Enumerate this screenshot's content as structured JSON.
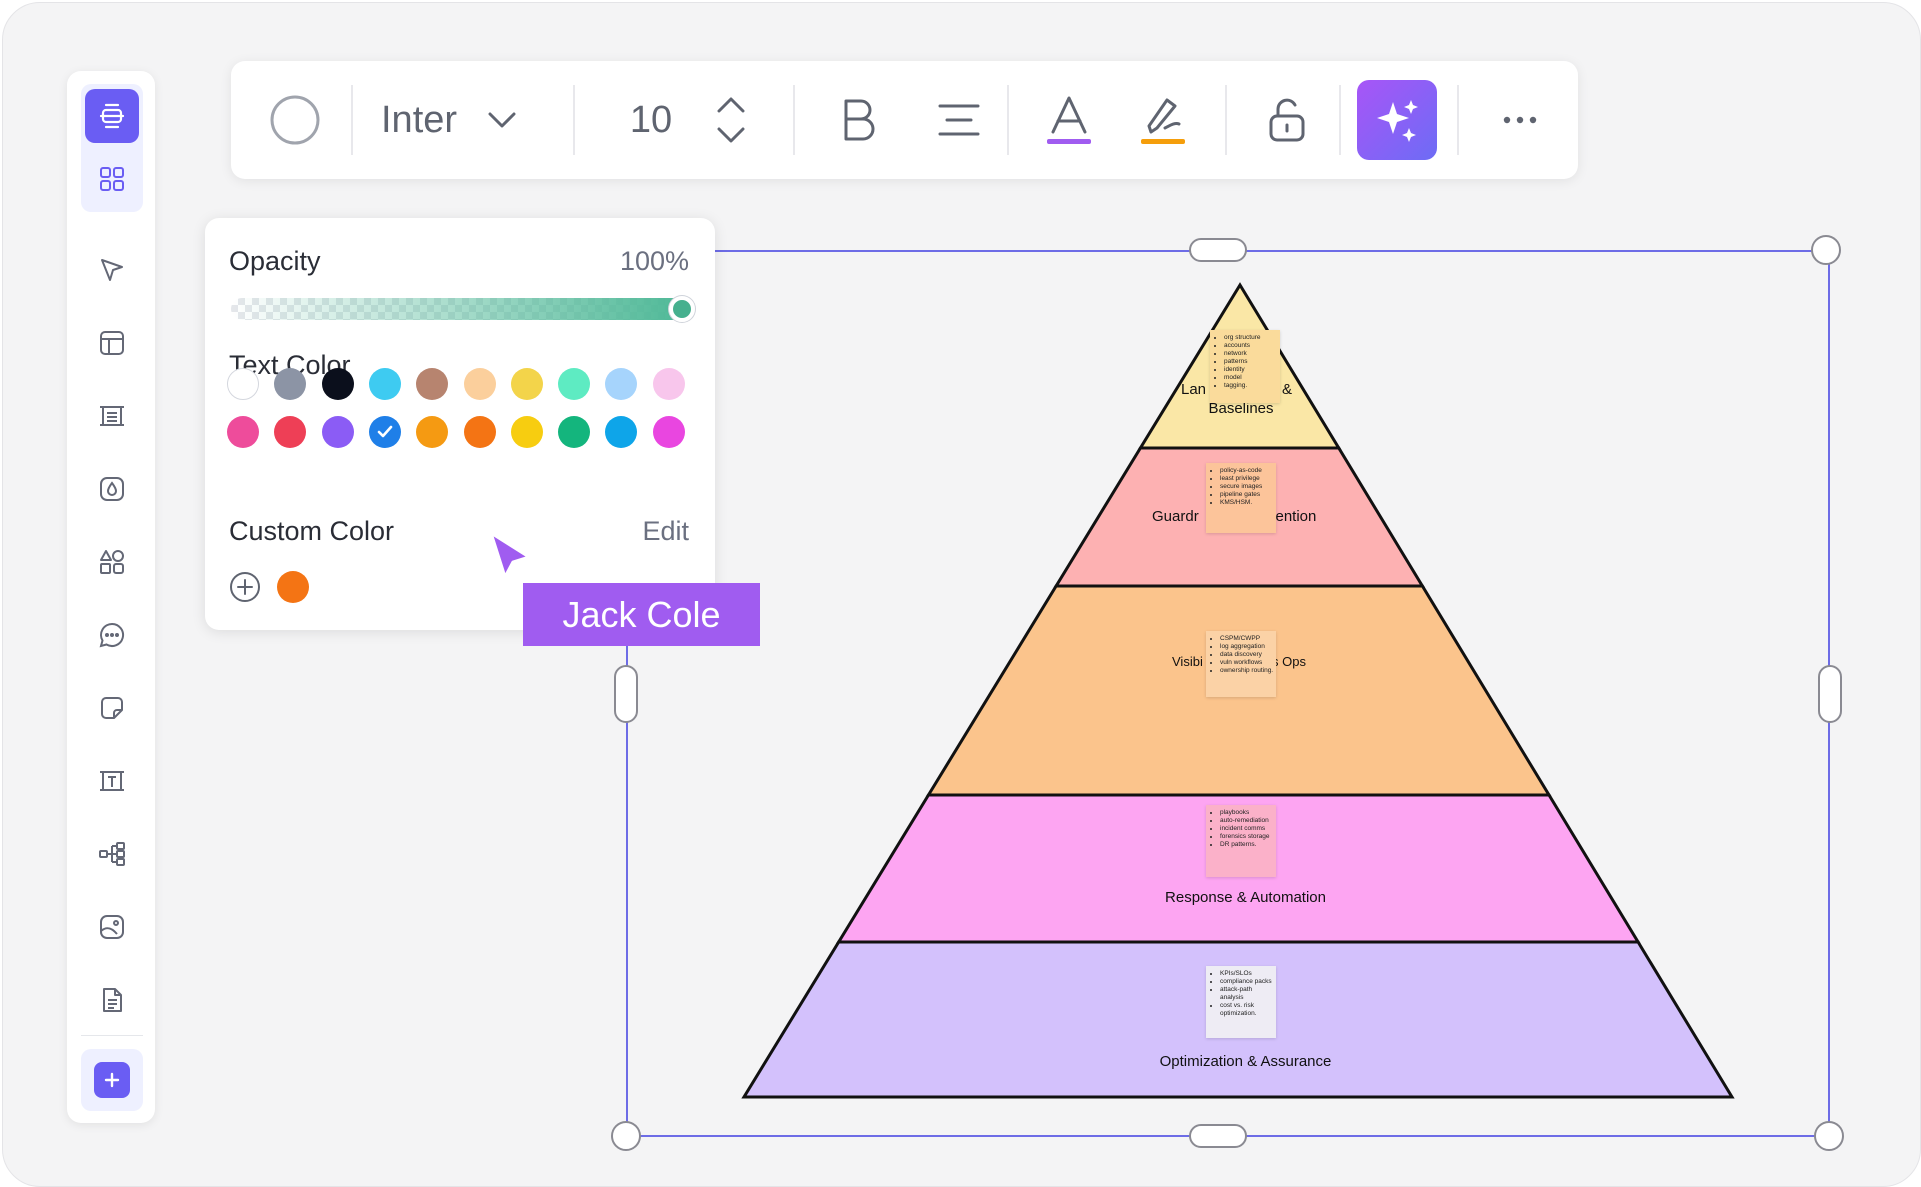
{
  "toolbar": {
    "font_family": "Inter",
    "font_size": "10",
    "icons": [
      "shape-circle-icon",
      "chevron-down-icon",
      "stepper-icon",
      "bold-icon",
      "align-center-icon",
      "text-color-icon",
      "highlight-icon",
      "unlock-icon",
      "ai-sparkle-icon",
      "more-icon"
    ],
    "text_color_underline": "#a05cf0",
    "highlight_underline": "#f59e0b"
  },
  "sidebar": {
    "items": [
      "present-icon",
      "grid-icon",
      "pointer-icon",
      "layout-icon",
      "frame-icon",
      "ink-icon",
      "shapes-icon",
      "comment-icon",
      "sticky-note-icon",
      "text-box-icon",
      "mindmap-icon",
      "image-icon",
      "document-icon",
      "add-icon"
    ]
  },
  "popover": {
    "opacity_label": "Opacity",
    "opacity_value": "100%",
    "opacity_fraction": 1.0,
    "text_color_label": "Text Color",
    "swatches_row1": [
      "#ffffff",
      "#8c94a5",
      "#0b0f1c",
      "#3ecbf1",
      "#b7846f",
      "#fbcf9c",
      "#f3d44a",
      "#5eebc2",
      "#a6d4fc",
      "#f8c6ec"
    ],
    "swatches_row2": [
      "#ee4c9b",
      "#ee3f56",
      "#8b5cf5",
      "#1f7fe8",
      "#f59a12",
      "#f47414",
      "#f7cd10",
      "#14b57d",
      "#0ea5e9",
      "#e946e0"
    ],
    "selected_swatch_index": 3,
    "custom_color_label": "Custom Color",
    "edit_label": "Edit",
    "custom_colors": [
      "#f47414"
    ]
  },
  "collaborator": {
    "name": "Jack Cole",
    "color": "#a05cf0"
  },
  "pyramid": {
    "layers": [
      {
        "label_left": "Lan",
        "label_right": "&",
        "label_line2": "Baselines",
        "fill": "#fae7a6",
        "note_items": [
          "org structure",
          "accounts",
          "network",
          "patterns",
          "identity",
          "model",
          "tagging."
        ],
        "note_color": "#fadb9b"
      },
      {
        "label_left": "Guardr",
        "label_right": "vention",
        "fill": "#fdb1b2",
        "note_items": [
          "policy-as-code",
          "least privilege",
          "secure images",
          "pipeline gates",
          "KMS/HSM."
        ],
        "note_color": "#fcc49a"
      },
      {
        "label_left": "Visibi",
        "label_right": "s Ops",
        "fill": "#fbc48c",
        "note_items": [
          "CSPM/CWPP",
          "log aggregation",
          "data discovery",
          "vuln workflows",
          "ownership routing."
        ],
        "note_color": "#fbd2a6"
      },
      {
        "label": "Response & Automation",
        "fill": "#fda5f2",
        "note_items": [
          "playbooks",
          "auto-remediation",
          "incident comms",
          "forensics storage",
          "DR patterns."
        ],
        "note_color": "#fbb1c9"
      },
      {
        "label": "Optimization & Assurance",
        "fill": "#d3c1fc",
        "note_items": [
          "KPIs/SLOs",
          "compliance packs",
          "attack-path analysis",
          "cost vs. risk optimization."
        ],
        "note_color": "#eeecf4"
      }
    ]
  }
}
